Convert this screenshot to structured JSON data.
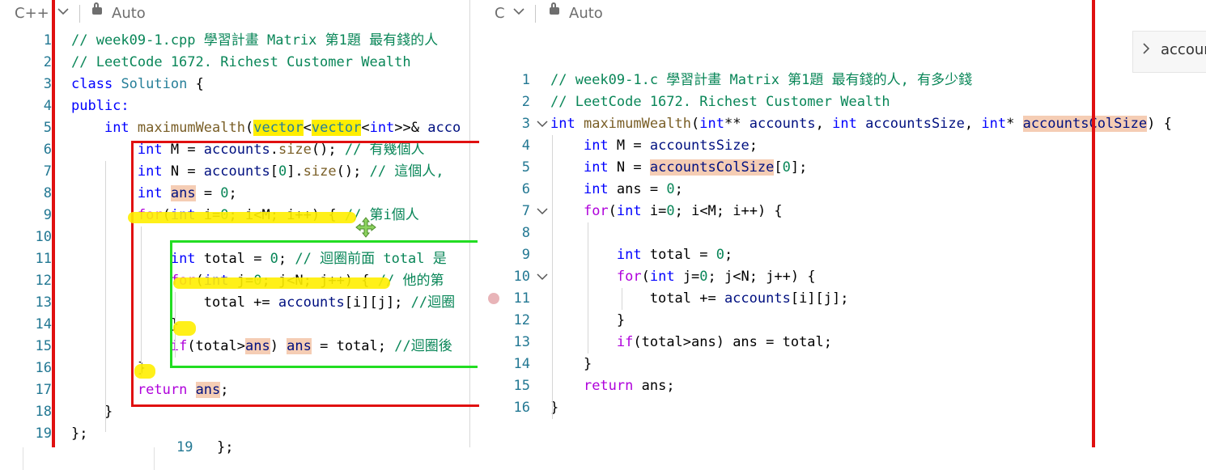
{
  "left_editor": {
    "language": "C++",
    "lock_mode": "Auto",
    "lines": [
      {
        "num": "1",
        "segments": [
          {
            "t": "// week09-1.cpp 學習計畫 Matrix 第1題 最有錢的人",
            "c": "cm"
          }
        ]
      },
      {
        "num": "2",
        "segments": [
          {
            "t": "// LeetCode 1672. Richest Customer Wealth",
            "c": "cm"
          }
        ]
      },
      {
        "num": "3",
        "segments": [
          {
            "t": "class",
            "c": "kw"
          },
          {
            "t": " "
          },
          {
            "t": "Solution",
            "c": "ty"
          },
          {
            "t": " {"
          }
        ]
      },
      {
        "num": "4",
        "segments": [
          {
            "t": "public:",
            "c": "kw"
          }
        ]
      },
      {
        "num": "5",
        "segments": [
          {
            "t": "    "
          },
          {
            "t": "int",
            "c": "kw"
          },
          {
            "t": " "
          },
          {
            "t": "maximumWealth",
            "c": "fn"
          },
          {
            "t": "("
          },
          {
            "t": "vector",
            "c": "ty yl"
          },
          {
            "t": "<"
          },
          {
            "t": "vector",
            "c": "ty yl"
          },
          {
            "t": "<"
          },
          {
            "t": "int",
            "c": "kw"
          },
          {
            "t": ">>& "
          },
          {
            "t": "acco",
            "c": "vr"
          }
        ]
      },
      {
        "num": "6",
        "segments": [
          {
            "t": "        "
          },
          {
            "t": "int",
            "c": "kw"
          },
          {
            "t": " M = "
          },
          {
            "t": "accounts",
            "c": "vr"
          },
          {
            "t": "."
          },
          {
            "t": "size",
            "c": "fn"
          },
          {
            "t": "(); "
          },
          {
            "t": "// 有幾個人",
            "c": "cm"
          }
        ]
      },
      {
        "num": "7",
        "segments": [
          {
            "t": "        "
          },
          {
            "t": "int",
            "c": "kw"
          },
          {
            "t": " N = "
          },
          {
            "t": "accounts",
            "c": "vr"
          },
          {
            "t": "["
          },
          {
            "t": "0",
            "c": "nm"
          },
          {
            "t": "]."
          },
          {
            "t": "size",
            "c": "fn"
          },
          {
            "t": "(); "
          },
          {
            "t": "// 這個人,",
            "c": "cm"
          }
        ]
      },
      {
        "num": "8",
        "segments": [
          {
            "t": "        "
          },
          {
            "t": "int",
            "c": "kw"
          },
          {
            "t": " "
          },
          {
            "t": "ans",
            "c": "vr hl"
          },
          {
            "t": " = "
          },
          {
            "t": "0",
            "c": "nm"
          },
          {
            "t": ";"
          }
        ]
      },
      {
        "num": "9",
        "segments": [
          {
            "t": "        "
          },
          {
            "t": "for",
            "c": "kw2"
          },
          {
            "t": "("
          },
          {
            "t": "int",
            "c": "kw"
          },
          {
            "t": " i="
          },
          {
            "t": "0",
            "c": "nm"
          },
          {
            "t": "; i<M; i++) { "
          },
          {
            "t": "// 第i個人",
            "c": "cm"
          }
        ]
      },
      {
        "num": "10",
        "segments": []
      },
      {
        "num": "11",
        "segments": [
          {
            "t": "            "
          },
          {
            "t": "int",
            "c": "kw"
          },
          {
            "t": " total = "
          },
          {
            "t": "0",
            "c": "nm"
          },
          {
            "t": "; "
          },
          {
            "t": "// 迴圈前面 total 是",
            "c": "cm"
          }
        ]
      },
      {
        "num": "12",
        "segments": [
          {
            "t": "            "
          },
          {
            "t": "for",
            "c": "kw2"
          },
          {
            "t": "("
          },
          {
            "t": "int",
            "c": "kw"
          },
          {
            "t": " j="
          },
          {
            "t": "0",
            "c": "nm"
          },
          {
            "t": "; j<N; j++) { "
          },
          {
            "t": "// 他的第",
            "c": "cm"
          }
        ]
      },
      {
        "num": "13",
        "segments": [
          {
            "t": "                total += "
          },
          {
            "t": "accounts",
            "c": "vr"
          },
          {
            "t": "[i][j]; "
          },
          {
            "t": "//迴圈",
            "c": "cm"
          }
        ]
      },
      {
        "num": "14",
        "segments": [
          {
            "t": "            }"
          }
        ]
      },
      {
        "num": "15",
        "segments": [
          {
            "t": "            "
          },
          {
            "t": "if",
            "c": "kw2"
          },
          {
            "t": "(total>"
          },
          {
            "t": "ans",
            "c": "vr hl"
          },
          {
            "t": ") "
          },
          {
            "t": "ans",
            "c": "vr hl"
          },
          {
            "t": " = total; "
          },
          {
            "t": "//迴圈後",
            "c": "cm"
          }
        ]
      },
      {
        "num": "16",
        "segments": [
          {
            "t": "        }"
          }
        ]
      },
      {
        "num": "17",
        "segments": [
          {
            "t": "        "
          },
          {
            "t": "return",
            "c": "kw2"
          },
          {
            "t": " "
          },
          {
            "t": "ans",
            "c": "vr hl"
          },
          {
            "t": ";"
          }
        ]
      },
      {
        "num": "18",
        "segments": [
          {
            "t": "    }"
          }
        ]
      },
      {
        "num": "19",
        "segments": [
          {
            "t": "};"
          }
        ]
      }
    ],
    "under_fragment_num": "19",
    "under_fragment_code": "};"
  },
  "right_editor": {
    "language": "C",
    "lock_mode": "Auto",
    "breadcrumb_text": "accoun",
    "lines": [
      {
        "num": "1",
        "segments": [
          {
            "t": "// week09-1.c 學習計畫 Matrix 第1題 最有錢的人, 有多少錢",
            "c": "cm"
          }
        ]
      },
      {
        "num": "2",
        "segments": [
          {
            "t": "// LeetCode 1672. Richest Customer Wealth",
            "c": "cm"
          }
        ]
      },
      {
        "num": "3",
        "segments": [
          {
            "t": "int",
            "c": "kw"
          },
          {
            "t": " "
          },
          {
            "t": "maximumWealth",
            "c": "fn"
          },
          {
            "t": "("
          },
          {
            "t": "int",
            "c": "kw"
          },
          {
            "t": "** "
          },
          {
            "t": "accounts",
            "c": "vr"
          },
          {
            "t": ", "
          },
          {
            "t": "int",
            "c": "kw"
          },
          {
            "t": " "
          },
          {
            "t": "accountsSize",
            "c": "vr"
          },
          {
            "t": ", "
          },
          {
            "t": "int",
            "c": "kw"
          },
          {
            "t": "* "
          },
          {
            "t": "accountsColSize",
            "c": "vr hl"
          },
          {
            "t": ") {"
          }
        ]
      },
      {
        "num": "4",
        "segments": [
          {
            "t": "    "
          },
          {
            "t": "int",
            "c": "kw"
          },
          {
            "t": " M = "
          },
          {
            "t": "accountsSize",
            "c": "vr"
          },
          {
            "t": ";"
          }
        ]
      },
      {
        "num": "5",
        "segments": [
          {
            "t": "    "
          },
          {
            "t": "int",
            "c": "kw"
          },
          {
            "t": " N = "
          },
          {
            "t": "accountsColSize",
            "c": "vr hl"
          },
          {
            "t": "["
          },
          {
            "t": "0",
            "c": "nm"
          },
          {
            "t": "];"
          }
        ]
      },
      {
        "num": "6",
        "segments": [
          {
            "t": "    "
          },
          {
            "t": "int",
            "c": "kw"
          },
          {
            "t": " ans = "
          },
          {
            "t": "0",
            "c": "nm"
          },
          {
            "t": ";"
          }
        ]
      },
      {
        "num": "7",
        "segments": [
          {
            "t": "    "
          },
          {
            "t": "for",
            "c": "kw2"
          },
          {
            "t": "("
          },
          {
            "t": "int",
            "c": "kw"
          },
          {
            "t": " i="
          },
          {
            "t": "0",
            "c": "nm"
          },
          {
            "t": "; i<M; i++) {"
          }
        ]
      },
      {
        "num": "8",
        "segments": []
      },
      {
        "num": "9",
        "segments": [
          {
            "t": "        "
          },
          {
            "t": "int",
            "c": "kw"
          },
          {
            "t": " total = "
          },
          {
            "t": "0",
            "c": "nm"
          },
          {
            "t": ";"
          }
        ]
      },
      {
        "num": "10",
        "segments": [
          {
            "t": "        "
          },
          {
            "t": "for",
            "c": "kw2"
          },
          {
            "t": "("
          },
          {
            "t": "int",
            "c": "kw"
          },
          {
            "t": " j="
          },
          {
            "t": "0",
            "c": "nm"
          },
          {
            "t": "; j<N; j++) {"
          }
        ]
      },
      {
        "num": "11",
        "segments": [
          {
            "t": "            total += "
          },
          {
            "t": "accounts",
            "c": "vr"
          },
          {
            "t": "[i][j];"
          }
        ]
      },
      {
        "num": "12",
        "segments": [
          {
            "t": "        }"
          }
        ]
      },
      {
        "num": "13",
        "segments": [
          {
            "t": "        "
          },
          {
            "t": "if",
            "c": "kw2"
          },
          {
            "t": "(total>ans) ans = total;"
          }
        ]
      },
      {
        "num": "14",
        "segments": [
          {
            "t": "    }"
          }
        ]
      },
      {
        "num": "15",
        "segments": [
          {
            "t": "    "
          },
          {
            "t": "return",
            "c": "kw2"
          },
          {
            "t": " ans;"
          }
        ]
      },
      {
        "num": "16",
        "segments": [
          {
            "t": "}"
          }
        ]
      }
    ]
  },
  "colors": {
    "annotation_red": "#e01010",
    "annotation_green": "#22dd22",
    "annotation_yellow": "#ffee00",
    "selection_highlight": "#f5cdb4",
    "line_number": "#237893"
  },
  "icons": [
    "chevron-down-icon",
    "lock-icon",
    "chevron-right-icon",
    "move-cursor-icon",
    "fold-chevron-icon"
  ]
}
